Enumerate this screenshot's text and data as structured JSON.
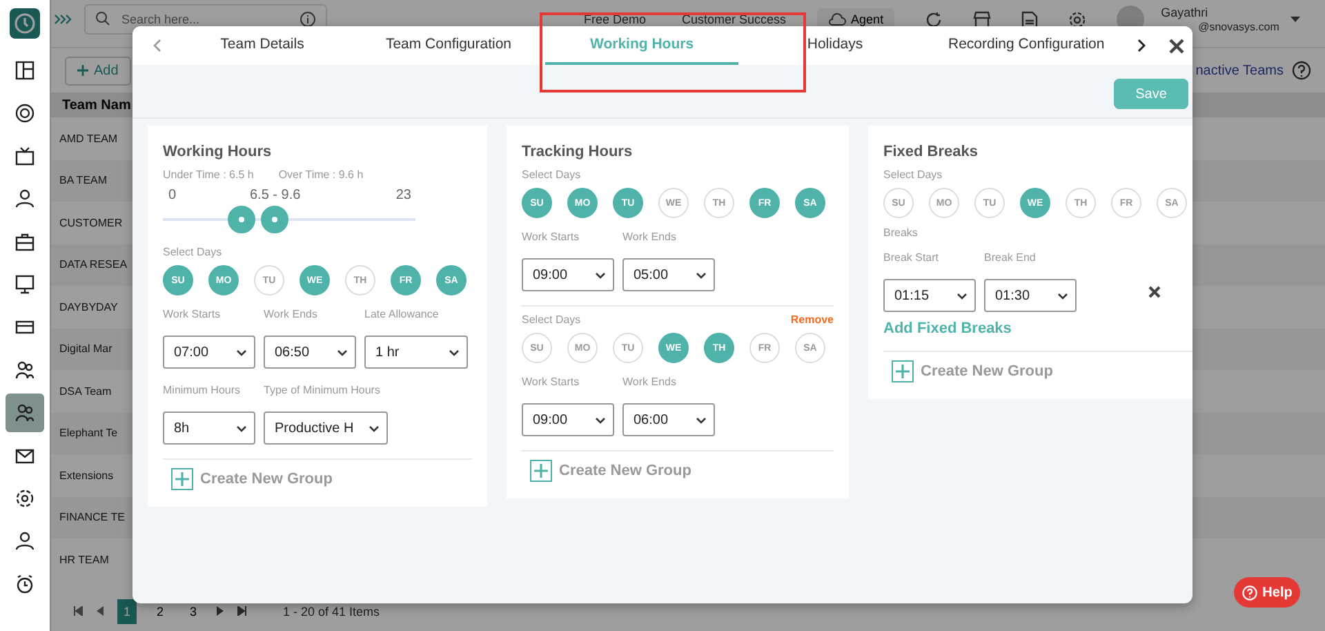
{
  "topbar": {
    "search_placeholder": "Search here...",
    "links": [
      "Free Demo",
      "Customer Success"
    ],
    "agent_button": "Agent",
    "user_name": "Gayathri",
    "user_email": "@snovasys.com"
  },
  "sidebar": {
    "items": [
      {
        "selected": false
      },
      {
        "selected": false
      },
      {
        "selected": false
      },
      {
        "selected": false
      },
      {
        "selected": false
      },
      {
        "selected": false
      },
      {
        "selected": false
      },
      {
        "selected": false
      },
      {
        "selected": true
      },
      {
        "selected": false
      },
      {
        "selected": false
      },
      {
        "selected": false
      },
      {
        "selected": false
      }
    ]
  },
  "toolbar": {
    "add_button": "Add",
    "inactive_link": "nactive Teams"
  },
  "table": {
    "column": "Team Nam",
    "rows": [
      "AMD TEAM",
      "BA TEAM",
      "CUSTOMER",
      "DATA RESEA",
      "DAYBYDAY",
      "Digital Mar",
      "DSA Team",
      "Elephant Te",
      "Extensions",
      "FINANCE TE",
      "HR TEAM"
    ]
  },
  "pagination": {
    "pages": [
      {
        "label": "1",
        "selected": true
      },
      {
        "label": "2",
        "selected": false
      },
      {
        "label": "3",
        "selected": false
      }
    ],
    "summary": "1 - 20 of 41 Items"
  },
  "help_button": "Help",
  "modal": {
    "tabs": [
      {
        "label": "Team Details",
        "selected": false
      },
      {
        "label": "Team Configuration",
        "selected": false
      },
      {
        "label": "Working Hours",
        "selected": true
      },
      {
        "label": "Holidays",
        "selected": false
      },
      {
        "label": "Recording Configuration",
        "selected": false
      }
    ],
    "save_button": "Save",
    "working_hours": {
      "title": "Working Hours",
      "under_time": "Under Time : 6.5 h",
      "over_time": "Over Time : 9.6 h",
      "slider": {
        "min": "0",
        "range": "6.5 - 9.6",
        "max": "23",
        "thumbs": [
          {
            "level": 0.31
          },
          {
            "level": 0.44
          }
        ]
      },
      "days_label": "Select Days",
      "days": [
        {
          "label": "SU",
          "selected": true
        },
        {
          "label": "MO",
          "selected": true
        },
        {
          "label": "TU",
          "selected": false
        },
        {
          "label": "WE",
          "selected": true
        },
        {
          "label": "TH",
          "selected": false
        },
        {
          "label": "FR",
          "selected": true
        },
        {
          "label": "SA",
          "selected": true
        }
      ],
      "fields": [
        {
          "label": "Work Starts",
          "value": "07:00"
        },
        {
          "label": "Work Ends",
          "value": "06:50"
        },
        {
          "label": "Late Allowance",
          "value": "1 hr"
        }
      ],
      "min_fields": [
        {
          "label": "Minimum Hours",
          "value": "8h"
        },
        {
          "label": "Type of Minimum Hours",
          "value": "Productive H"
        }
      ],
      "create_group": "Create New Group"
    },
    "tracking_hours": {
      "title": "Tracking Hours",
      "groups": [
        {
          "days_label": "Select Days",
          "days": [
            {
              "label": "SU",
              "selected": true
            },
            {
              "label": "MO",
              "selected": true
            },
            {
              "label": "TU",
              "selected": true
            },
            {
              "label": "WE",
              "selected": false
            },
            {
              "label": "TH",
              "selected": false
            },
            {
              "label": "FR",
              "selected": true
            },
            {
              "label": "SA",
              "selected": true
            }
          ],
          "fields": [
            {
              "label": "Work Starts",
              "value": "09:00"
            },
            {
              "label": "Work Ends",
              "value": "05:00"
            }
          ]
        },
        {
          "days_label": "Select Days",
          "remove": "Remove",
          "days": [
            {
              "label": "SU",
              "selected": false
            },
            {
              "label": "MO",
              "selected": false
            },
            {
              "label": "TU",
              "selected": false
            },
            {
              "label": "WE",
              "selected": true
            },
            {
              "label": "TH",
              "selected": true
            },
            {
              "label": "FR",
              "selected": false
            },
            {
              "label": "SA",
              "selected": false
            }
          ],
          "fields": [
            {
              "label": "Work Starts",
              "value": "09:00"
            },
            {
              "label": "Work Ends",
              "value": "06:00"
            }
          ]
        }
      ],
      "create_group": "Create New Group"
    },
    "fixed_breaks": {
      "title": "Fixed Breaks",
      "days_label": "Select Days",
      "days": [
        {
          "label": "SU",
          "selected": false
        },
        {
          "label": "MO",
          "selected": false
        },
        {
          "label": "TU",
          "selected": false
        },
        {
          "label": "WE",
          "selected": true
        },
        {
          "label": "TH",
          "selected": false
        },
        {
          "label": "FR",
          "selected": false
        },
        {
          "label": "SA",
          "selected": false
        }
      ],
      "breaks_label": "Breaks",
      "fields": [
        {
          "label": "Break Start",
          "value": "01:15"
        },
        {
          "label": "Break End",
          "value": "01:30"
        }
      ],
      "add_breaks": "Add Fixed Breaks",
      "create_group": "Create New Group"
    }
  }
}
